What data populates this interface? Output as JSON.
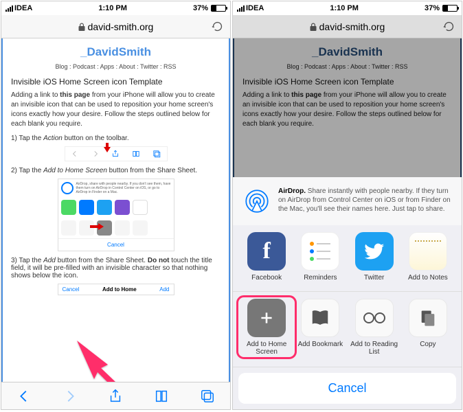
{
  "status": {
    "carrier": "IDEA",
    "time": "1:10 PM",
    "battery_pct": "37%"
  },
  "url": "david-smith.org",
  "site": {
    "title": "_DavidSmith",
    "nav": "Blog : Podcast : Apps : About : Twitter : RSS"
  },
  "article": {
    "title": "Invisible iOS Home Screen icon Template",
    "intro_pre": "Adding a link to ",
    "intro_bold": "this page",
    "intro_post": " from your iPhone will allow you to create an invisible icon that can be used to reposition your home screen's icons exactly how your desire. Follow the steps outlined below for each blank you require.",
    "step1_pre": "1) Tap the ",
    "step1_em": "Action",
    "step1_post": " button on the toolbar.",
    "step2_pre": "2) Tap the ",
    "step2_em": "Add to Home Screen",
    "step2_post": " button from the Share Sheet.",
    "step3_pre": "3) Tap the ",
    "step3_em": "Add",
    "step3_post": " button from the Share Sheet. ",
    "step3_bold": "Do not",
    "step3_tail": " touch the title field, it will be pre-filled with an invisible character so that nothing shows below the icon."
  },
  "mini": {
    "airdrop_text": "AirDrop, share with people nearby. If you don't see them, have them turn on AirDrop in Control Center on iOS, or go to AirDrop in Finder on a Mac.",
    "cancel": "Cancel",
    "add_to_home_title": "Add to Home",
    "add_label": "Add",
    "cancel_label": "Cancel"
  },
  "share": {
    "airdrop_bold": "AirDrop.",
    "airdrop_text": " Share instantly with people nearby. If they turn on AirDrop from Control Center on iOS or from Finder on the Mac, you'll see their names here. Just tap to share.",
    "apps": [
      {
        "label": "Facebook"
      },
      {
        "label": "Reminders"
      },
      {
        "label": "Twitter"
      },
      {
        "label": "Add to Notes"
      }
    ],
    "actions": [
      {
        "label": "Add to Home Screen"
      },
      {
        "label": "Add Bookmark"
      },
      {
        "label": "Add to Reading List"
      },
      {
        "label": "Copy"
      }
    ],
    "cancel": "Cancel"
  }
}
